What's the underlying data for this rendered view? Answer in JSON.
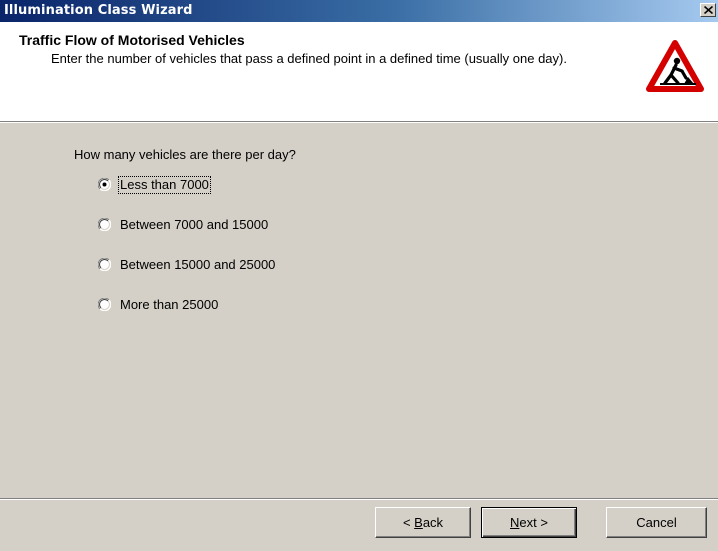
{
  "window": {
    "title": "Illumination Class Wizard",
    "close_icon": "close-icon"
  },
  "header": {
    "title": "Traffic Flow of Motorised Vehicles",
    "description": "Enter the number of vehicles that pass a defined point in a defined time (usually one day).",
    "icon": "roadworks-warning-icon"
  },
  "question": "How many vehicles are there per day?",
  "options": [
    {
      "label": "Less than 7000",
      "selected": true
    },
    {
      "label": "Between 7000 and 15000",
      "selected": false
    },
    {
      "label": "Between 15000 and 25000",
      "selected": false
    },
    {
      "label": "More than 25000",
      "selected": false
    }
  ],
  "buttons": {
    "back_label": "< Back",
    "next_label": "Next >",
    "cancel_label": "Cancel"
  },
  "colors": {
    "dialog_bg": "#d4d0c8",
    "titlebar_start": "#0a246a",
    "titlebar_end": "#a6caf0",
    "warning_red": "#d40000"
  }
}
